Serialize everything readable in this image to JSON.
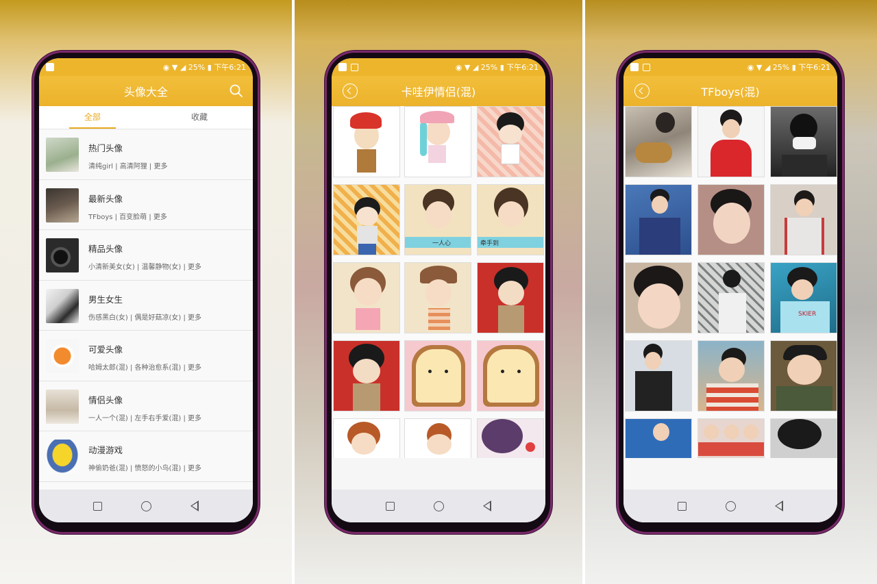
{
  "status": {
    "time": "下午6:21",
    "battery": "25%"
  },
  "home": {
    "title": "头像大全",
    "tabs": [
      "全部",
      "收藏"
    ],
    "categories": [
      {
        "name": "热门头像",
        "sub": "清纯girl | 高清阿狸 | 更多"
      },
      {
        "name": "最新头像",
        "sub": "TFboys | 百变脸萌 | 更多"
      },
      {
        "name": "精品头像",
        "sub": "小清新美女(女) | 温馨静物(女) | 更多"
      },
      {
        "name": "男生女生",
        "sub": "伤感黑白(女) | 偶是好菇凉(女) | 更多"
      },
      {
        "name": "可爱头像",
        "sub": "哈姆太郎(混) | 各种治愈系(混) | 更多"
      },
      {
        "name": "情侣头像",
        "sub": "一人一个(混) | 左手右手爱(混) | 更多"
      },
      {
        "name": "动漫游戏",
        "sub": "神偷奶爸(混) | 愤怒的小鸟(混) | 更多"
      }
    ]
  },
  "gallery_cartoon": {
    "title": "卡哇伊情侣(混)",
    "caption_a": "一人心",
    "caption_b": "牵手到"
  },
  "gallery_photo": {
    "title": "TFboys(混)"
  },
  "colors": {
    "accent": "#ecb22b",
    "active_tab": "#e8a91e",
    "frame": "#7a2a6a"
  },
  "icons": [
    "search-icon",
    "back-icon",
    "home-icon",
    "recents-icon",
    "back-nav-icon"
  ]
}
